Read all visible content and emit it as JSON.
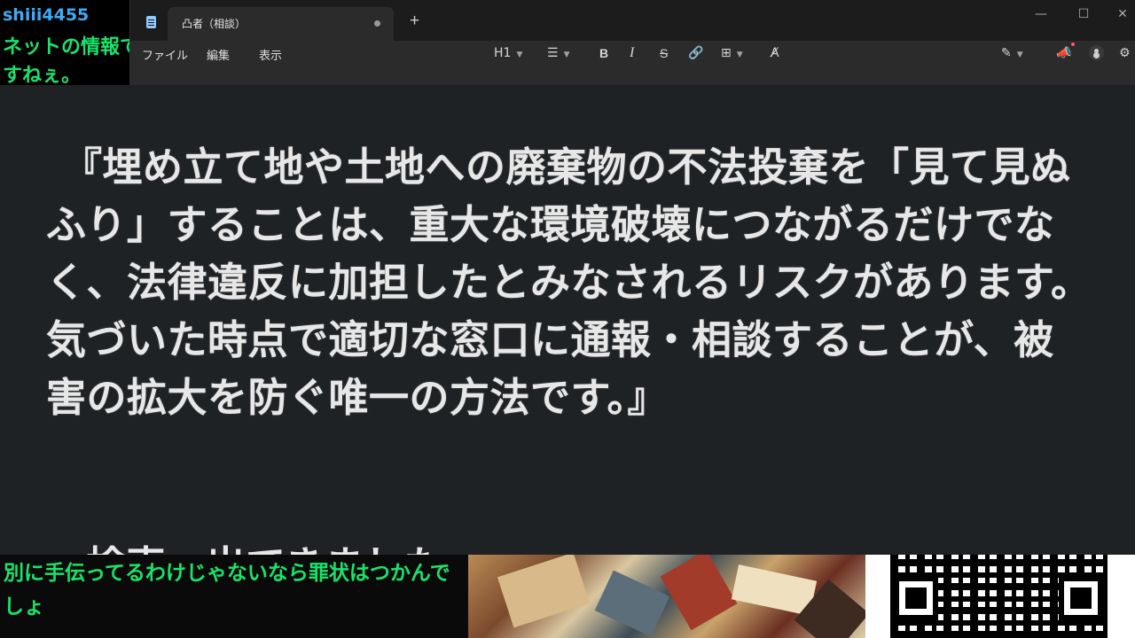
{
  "chat_top": {
    "username": "shiii4455",
    "message": "ネットの情報ですねぇ。"
  },
  "window": {
    "tab_title": "凸者（相談）",
    "new_tab": "+",
    "controls": {
      "minimize": "—",
      "maximize": "☐",
      "close": "✕"
    }
  },
  "menu": {
    "items": [
      "ファイル",
      "編集",
      "表示"
    ]
  },
  "toolbar": {
    "heading": "H1",
    "list": "☰",
    "bold": "B",
    "italic": "I",
    "strike": "S",
    "link": "🔗",
    "table": "⊞",
    "clear_format": "A̸",
    "copilot": "✎",
    "notify": "📣",
    "settings": "⚙"
  },
  "editor": {
    "paragraph_1": "『埋め立て地や土地への廃棄物の不法投棄を「見て見ぬふり」することは、重大な環境破壊につながるだけでなく、法律違反に加担したとみなされるリスクがあります。",
    "paragraph_2": "気づいた時点で適切な窓口に通報・相談することが、被害の拡大を防ぐ唯一の方法です。』",
    "cut_line": "・検索　出てきました"
  },
  "chat_bottom": {
    "message": "別に手伝ってるわけじゃないなら罪状はつかんでしょ"
  }
}
